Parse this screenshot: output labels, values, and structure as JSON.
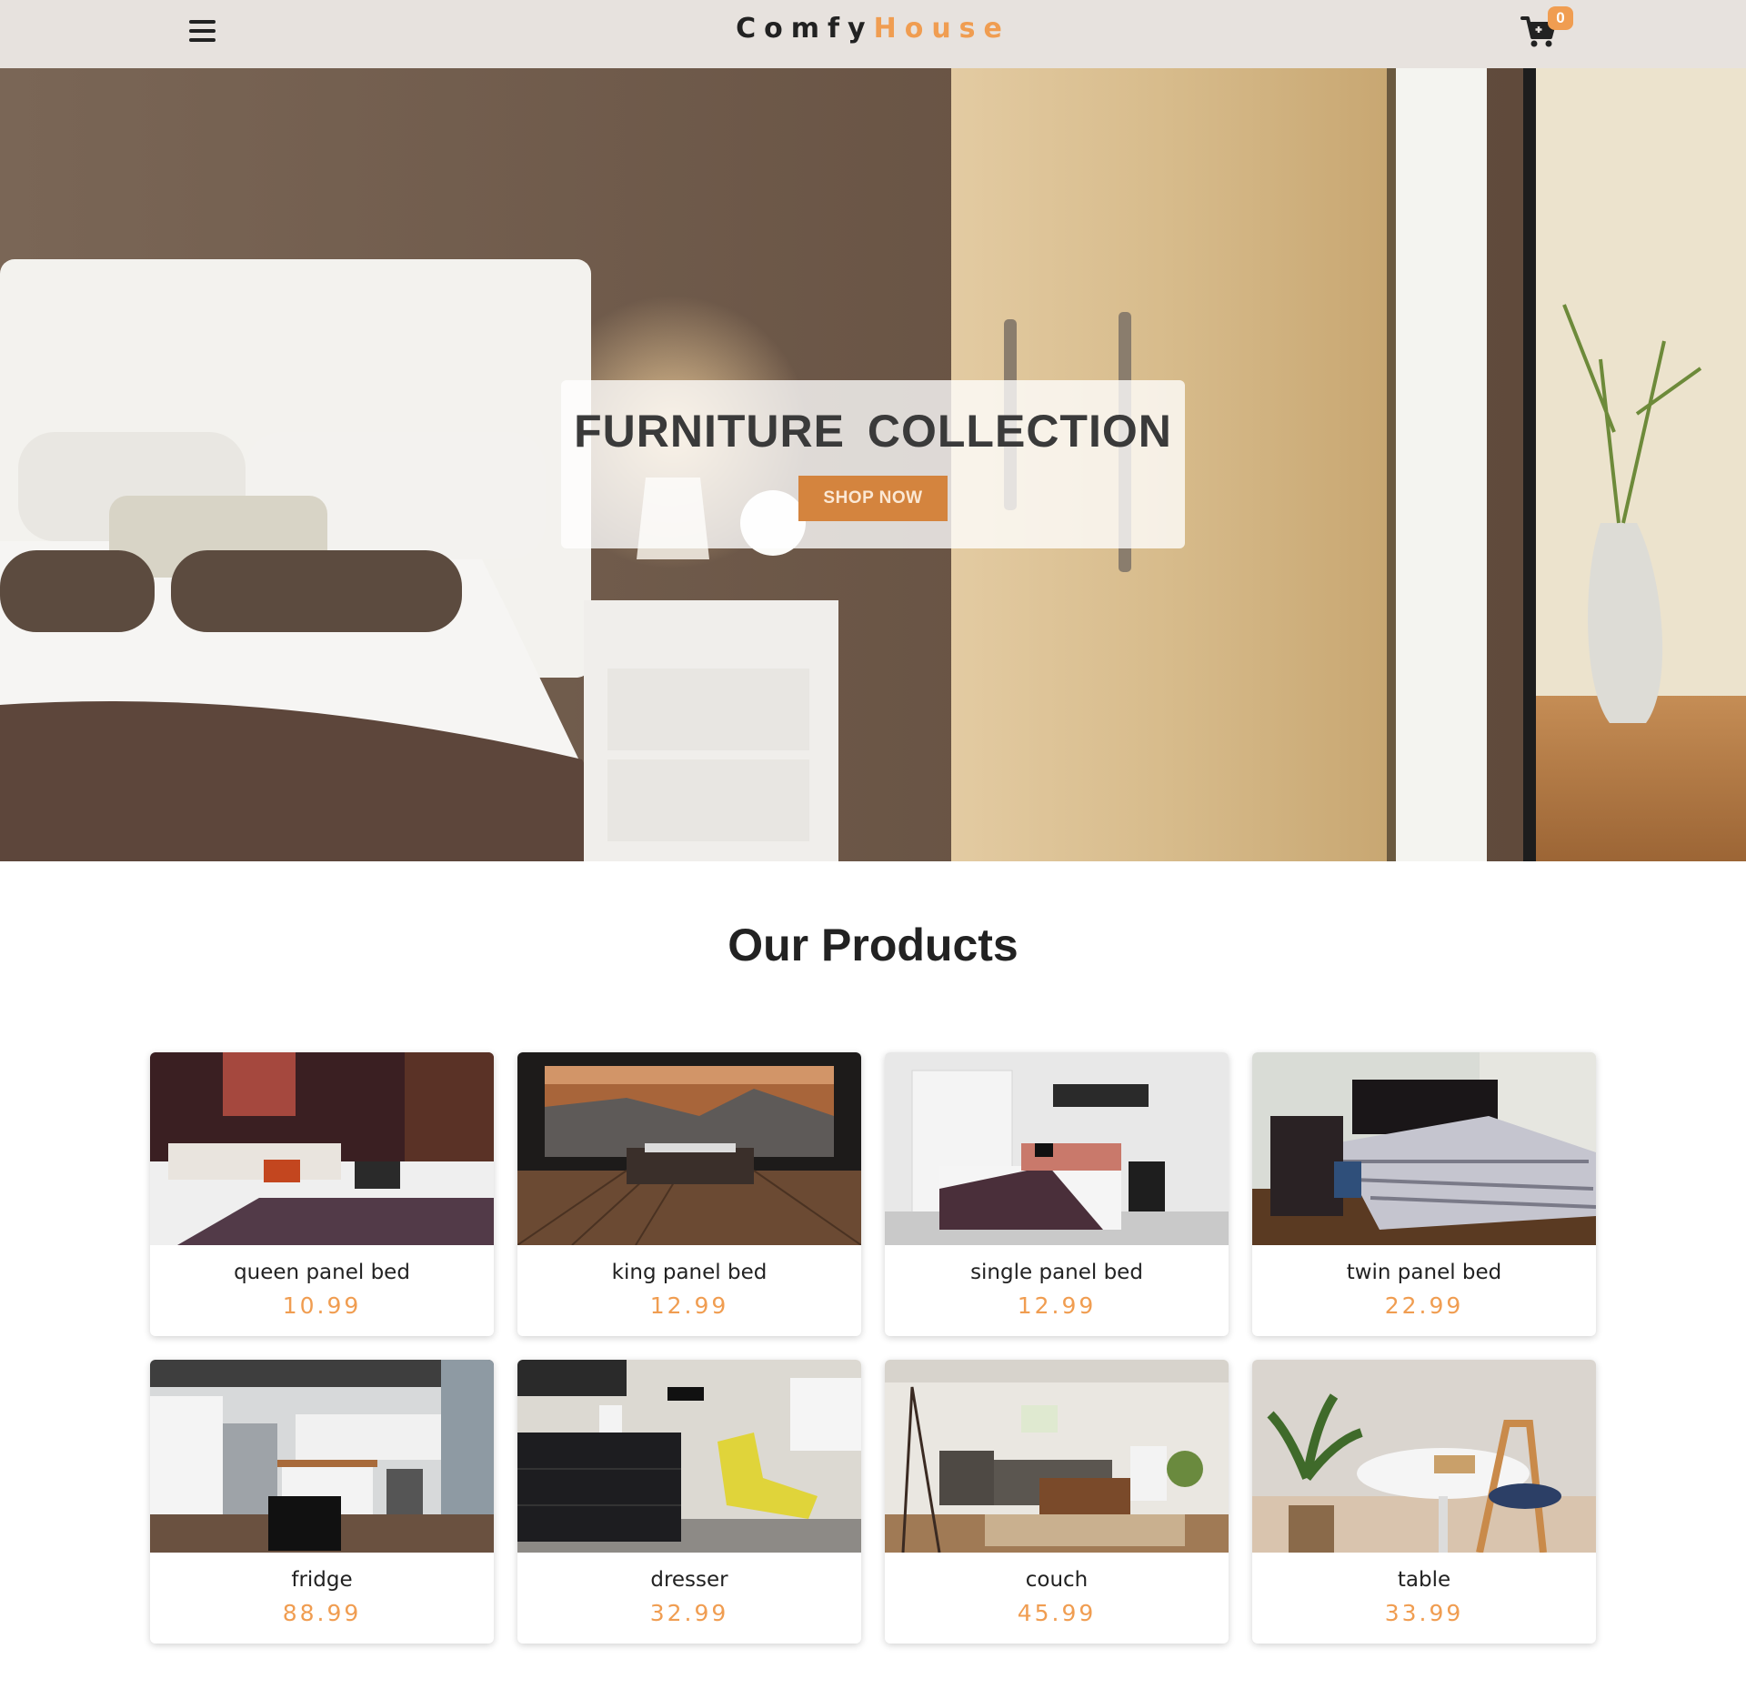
{
  "navbar": {
    "logo_part1": "Comfy",
    "logo_part2": "House",
    "cart_count": "0",
    "accent_color": "#f09d51"
  },
  "hero": {
    "title": "FURNITURE COLLECTION",
    "button_label": "SHOP NOW"
  },
  "products": {
    "title": "Our Products",
    "items": [
      {
        "name": "queen panel bed",
        "price": "10.99"
      },
      {
        "name": "king panel bed",
        "price": "12.99"
      },
      {
        "name": "single panel bed",
        "price": "12.99"
      },
      {
        "name": "twin panel bed",
        "price": "22.99"
      },
      {
        "name": "fridge",
        "price": "88.99"
      },
      {
        "name": "dresser",
        "price": "32.99"
      },
      {
        "name": "couch",
        "price": "45.99"
      },
      {
        "name": "table",
        "price": "33.99"
      }
    ]
  }
}
